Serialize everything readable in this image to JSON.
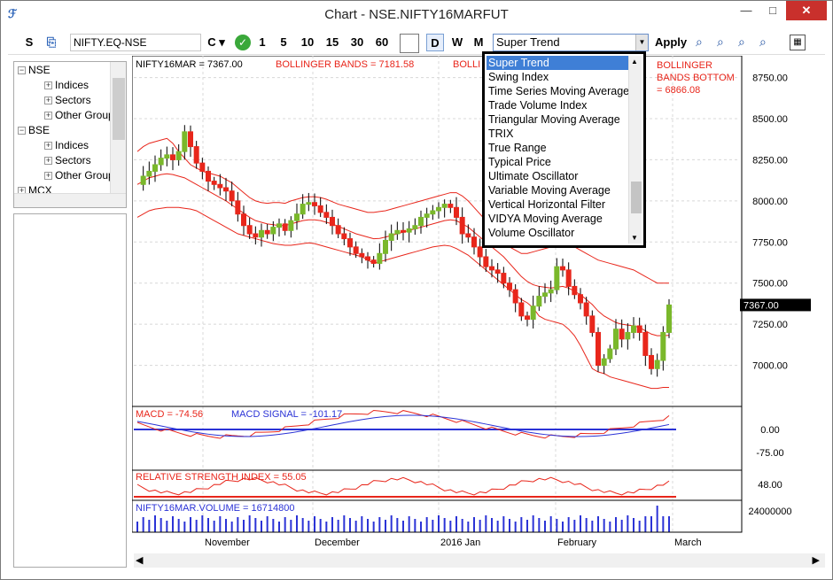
{
  "window": {
    "title": "Chart - NSE.NIFTY16MARFUT",
    "minimize": "—",
    "maximize": "□",
    "close": "✕"
  },
  "toolbar": {
    "s_label": "S",
    "symbol_value": "NIFTY.EQ-NSE",
    "chart_type": "C ▾",
    "intervals": [
      "1",
      "5",
      "10",
      "15",
      "30",
      "60"
    ],
    "timeframes": [
      "D",
      "W",
      "M"
    ],
    "indicator_selected": "Super Trend",
    "apply_label": "Apply"
  },
  "tree": [
    {
      "label": "NSE",
      "level": 0,
      "sign": "−"
    },
    {
      "label": "Indices",
      "level": 1,
      "sign": "+"
    },
    {
      "label": "Sectors",
      "level": 1,
      "sign": "+"
    },
    {
      "label": "Other Group",
      "level": 1,
      "sign": "+"
    },
    {
      "label": "BSE",
      "level": 0,
      "sign": "−"
    },
    {
      "label": "Indices",
      "level": 1,
      "sign": "+"
    },
    {
      "label": "Sectors",
      "level": 1,
      "sign": "+"
    },
    {
      "label": "Other Group",
      "level": 1,
      "sign": "+"
    },
    {
      "label": "MCX",
      "level": 0,
      "sign": "+"
    }
  ],
  "indicator_options": [
    "Super Trend",
    "Swing Index",
    "Time Series Moving Average",
    "Trade Volume Index",
    "Triangular Moving Average",
    "TRIX",
    "True Range",
    "Typical Price",
    "Ultimate Oscillator",
    "Variable Moving Average",
    "Vertical Horizontal Filter",
    "VIDYA Moving Average",
    "Volume Oscillator"
  ],
  "panels": {
    "price_label": "NIFTY16MAR = 7367.00",
    "bb_label": "BOLLINGER BANDS = 7181.58",
    "bb_label_partial": "BOLLI",
    "bb_bottom_label1": "BOLLINGER",
    "bb_bottom_label2": "BANDS BOTTOM",
    "bb_bottom_label3": "= 6866.08",
    "macd_label": "MACD = -74.56",
    "macd_signal_label": "MACD SIGNAL = -101.17",
    "rsi_label": "RELATIVE STRENGTH INDEX = 55.05",
    "volume_label": "NIFTY16MAR.VOLUME = 16714800",
    "last_price": "7367.00"
  },
  "colors": {
    "up": "#7ab82b",
    "down": "#e8261b",
    "band": "#e8261b",
    "macd": "#e8261b",
    "signal": "#2b33d6",
    "volume": "#2b33d6"
  },
  "chart_data": {
    "type": "candlestick",
    "price_axis": {
      "range": [
        6750,
        8850
      ],
      "ticks": [
        "8750.00",
        "8500.00",
        "8250.00",
        "8000.00",
        "7750.00",
        "7500.00",
        "7250.00",
        "7000.00"
      ]
    },
    "macd_axis": {
      "ticks": [
        "0.00",
        "-75.00"
      ]
    },
    "rsi_axis": {
      "ticks": [
        "48.00"
      ]
    },
    "volume_axis": {
      "ticks": [
        "24000000"
      ]
    },
    "x_labels": [
      "November",
      "December",
      "2016 Jan",
      "February",
      "March"
    ],
    "close": [
      8100,
      8150,
      8180,
      8220,
      8260,
      8280,
      8250,
      8300,
      8420,
      8330,
      8230,
      8180,
      8120,
      8100,
      8080,
      8060,
      8000,
      7920,
      7850,
      7800,
      7780,
      7820,
      7800,
      7840,
      7860,
      7820,
      7880,
      7920,
      7980,
      7990,
      7970,
      7930,
      7900,
      7850,
      7800,
      7770,
      7720,
      7680,
      7660,
      7640,
      7620,
      7680,
      7760,
      7800,
      7820,
      7810,
      7830,
      7850,
      7900,
      7920,
      7940,
      7960,
      7980,
      7960,
      7900,
      7800,
      7780,
      7720,
      7660,
      7600,
      7580,
      7560,
      7500,
      7460,
      7380,
      7300,
      7280,
      7360,
      7420,
      7440,
      7460,
      7600,
      7580,
      7480,
      7430,
      7380,
      7300,
      7200,
      7000,
      7040,
      7100,
      7220,
      7160,
      7200,
      7240,
      7200,
      7060,
      6980,
      7030,
      7200,
      7367
    ],
    "bb_upper": [
      8300,
      8330,
      8350,
      8360,
      8370,
      8380,
      8350,
      8300,
      8260,
      8220,
      8200,
      8180,
      8170,
      8160,
      8150,
      8130,
      8110,
      8080,
      8050,
      8020,
      8000,
      7990,
      7985,
      7990,
      7990,
      7985,
      8000,
      8010,
      8020,
      8025,
      8025,
      8020,
      8010,
      7995,
      7980,
      7970,
      7960,
      7950,
      7940,
      7930,
      7930,
      7935,
      7940,
      7950,
      7960,
      7970,
      7980,
      7990,
      8000,
      8010,
      8020,
      8030,
      8040,
      8050,
      8050,
      8030,
      8000,
      7960,
      7920,
      7880,
      7840,
      7800,
      7760,
      7720,
      7700,
      7680,
      7680,
      7690,
      7700,
      7710,
      7720,
      7740,
      7750,
      7740,
      7720,
      7700,
      7680,
      7660,
      7640,
      7630,
      7620,
      7610,
      7600,
      7590,
      7580,
      7560,
      7540,
      7520,
      7500,
      7500,
      7500
    ],
    "bb_mid": [
      8100,
      8120,
      8140,
      8150,
      8160,
      8165,
      8160,
      8150,
      8140,
      8120,
      8100,
      8080,
      8060,
      8040,
      8020,
      8000,
      7975,
      7950,
      7925,
      7900,
      7880,
      7870,
      7860,
      7855,
      7850,
      7850,
      7860,
      7870,
      7880,
      7885,
      7885,
      7880,
      7870,
      7860,
      7845,
      7830,
      7815,
      7800,
      7790,
      7780,
      7770,
      7772,
      7780,
      7790,
      7800,
      7810,
      7820,
      7830,
      7840,
      7850,
      7860,
      7870,
      7880,
      7885,
      7880,
      7860,
      7840,
      7810,
      7780,
      7750,
      7720,
      7690,
      7660,
      7620,
      7580,
      7540,
      7510,
      7490,
      7480,
      7475,
      7470,
      7475,
      7480,
      7470,
      7450,
      7430,
      7400,
      7370,
      7330,
      7300,
      7280,
      7260,
      7250,
      7245,
      7240,
      7230,
      7210,
      7190,
      7180,
      7181,
      7182
    ],
    "bb_lower": [
      7900,
      7920,
      7940,
      7950,
      7955,
      7960,
      7960,
      7960,
      7955,
      7950,
      7940,
      7920,
      7900,
      7880,
      7860,
      7840,
      7820,
      7800,
      7790,
      7780,
      7770,
      7760,
      7750,
      7740,
      7735,
      7730,
      7730,
      7735,
      7740,
      7745,
      7740,
      7730,
      7720,
      7710,
      7700,
      7690,
      7680,
      7670,
      7660,
      7640,
      7620,
      7630,
      7640,
      7650,
      7660,
      7670,
      7680,
      7690,
      7700,
      7710,
      7720,
      7725,
      7730,
      7725,
      7710,
      7690,
      7670,
      7640,
      7610,
      7580,
      7550,
      7520,
      7490,
      7460,
      7430,
      7400,
      7380,
      7350,
      7300,
      7280,
      7270,
      7260,
      7250,
      7220,
      7180,
      7120,
      7050,
      6980,
      6960,
      6950,
      6930,
      6920,
      6910,
      6900,
      6890,
      6880,
      6870,
      6860,
      6860,
      6866,
      6866
    ],
    "volume_count": 91,
    "series": [
      {
        "name": "MACD"
      },
      {
        "name": "MACD SIGNAL"
      },
      {
        "name": "RELATIVE STRENGTH INDEX"
      },
      {
        "name": "NIFTY16MAR.VOLUME"
      }
    ]
  }
}
